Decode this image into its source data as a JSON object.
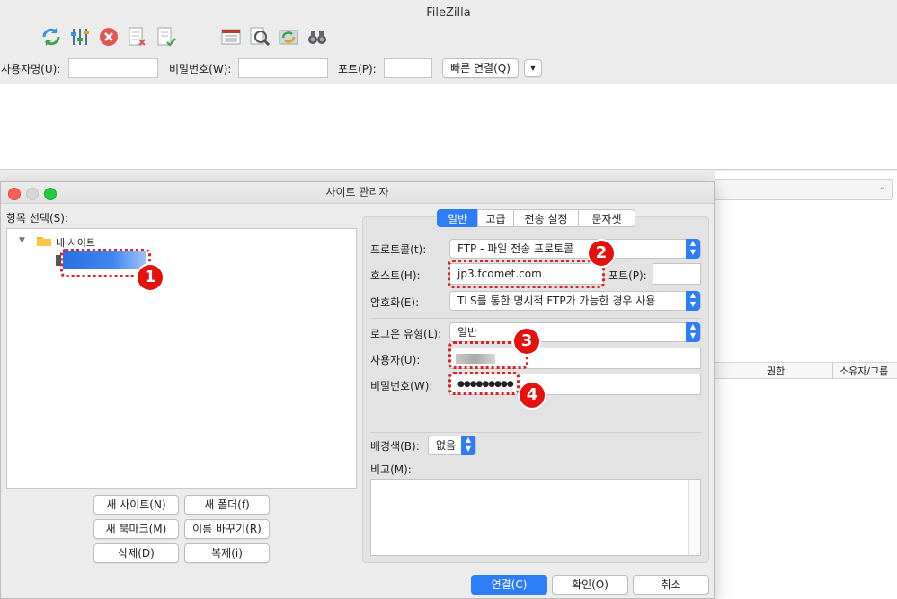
{
  "app_title": "FileZilla",
  "quickconnect": {
    "user_label": "사용자명(U):",
    "password_label": "비밀번호(W):",
    "port_label": "포트(P):",
    "connect_label": "빠른 연결(Q)"
  },
  "background": {
    "col_permissions": "권한",
    "col_owner": "소유자/그룹"
  },
  "dialog": {
    "title": "사이트 관리자",
    "select_label": "항목 선택(S):",
    "tree": {
      "root_label": "내 사이트"
    },
    "buttons": {
      "new_site": "새 사이트(N)",
      "new_folder": "새 폴더(f)",
      "new_bookmark": "새 북마크(M)",
      "rename": "이름 바꾸기(R)",
      "delete": "삭제(D)",
      "duplicate": "복제(i)"
    },
    "tabs": [
      "일반",
      "고급",
      "전송 설정",
      "문자셋"
    ],
    "fields": {
      "protocol_label": "프로토콜(t):",
      "protocol_value": "FTP - 파일 전송 프로토콜",
      "host_label": "호스트(H):",
      "host_value": "jp3.fcomet.com",
      "port_label": "포트(P):",
      "encryption_label": "암호화(E):",
      "encryption_value": "TLS를 통한 명시적 FTP가 가능한 경우 사용",
      "logon_label": "로그온 유형(L):",
      "logon_value": "일반",
      "user_label": "사용자(U):",
      "password_label": "비밀번호(W):",
      "password_value": "●●●●●●●●●",
      "bgcolor_label": "배경색(B):",
      "bgcolor_value": "없음",
      "comments_label": "비고(M):"
    },
    "footer": {
      "connect": "연결(C)",
      "ok": "확인(O)",
      "cancel": "취소"
    }
  },
  "annotations": [
    "1",
    "2",
    "3",
    "4"
  ],
  "colors": {
    "accent": "#2d7df6",
    "annotation": "#e4120f",
    "selection": "#2b6fe0"
  }
}
